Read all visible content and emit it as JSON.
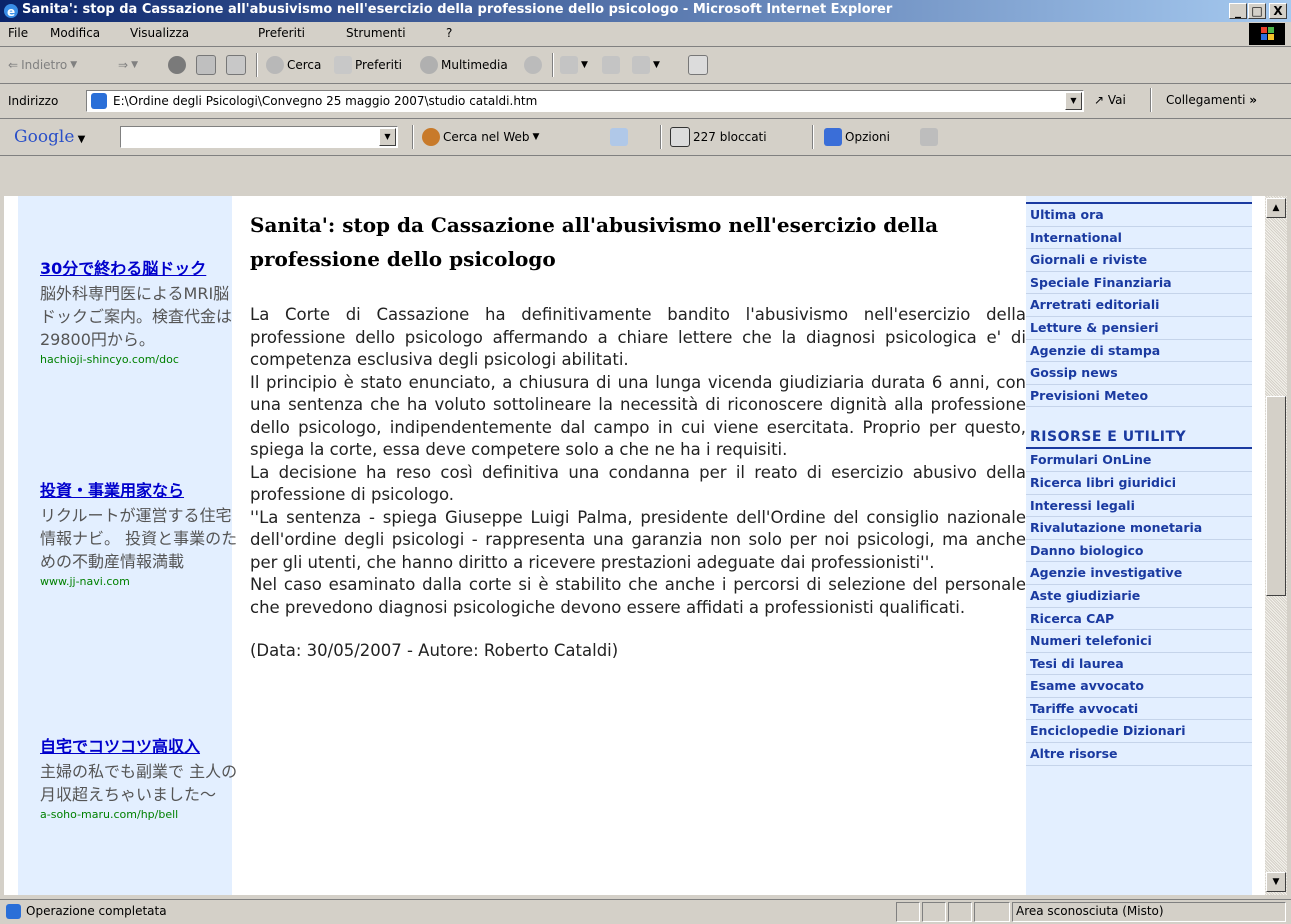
{
  "window": {
    "title": "Sanita': stop da Cassazione all'abusivismo nell'esercizio della professione dello psicologo - Microsoft Internet Explorer",
    "min_label": "_",
    "max_label": "□",
    "close_label": "X"
  },
  "menu": {
    "file": "File",
    "modifica": "Modifica",
    "visualizza": "Visualizza",
    "preferiti": "Preferiti",
    "strumenti": "Strumenti",
    "help": "?"
  },
  "toolbar": {
    "back": "Indietro",
    "search": "Cerca",
    "favorites": "Preferiti",
    "media": "Multimedia"
  },
  "address": {
    "label": "Indirizzo",
    "value": "E:\\Ordine degli Psicologi\\Convegno 25 maggio 2007\\studio cataldi.htm",
    "go": "Vai",
    "links": "Collegamenti"
  },
  "googlebar": {
    "logo": "Google",
    "search_web": "Cerca nel Web",
    "blocked": "227 bloccati",
    "options": "Opzioni",
    "search_value": ""
  },
  "ads": [
    {
      "title": "30分で終わる脳ドック",
      "body": "脳外科専門医によるMRI脳ドックご案内。検査代金は29800円から。",
      "url": "hachioji-shincyo.com/doc"
    },
    {
      "title": "投資・事業用家なら",
      "body": "リクルートが運営する住宅情報ナビ。 投資と事業のための不動産情報満載",
      "url": "www.jj-navi.com"
    },
    {
      "title": "自宅でコツコツ高収入",
      "body": "主婦の私でも副業で 主人の月収超えちゃいました～",
      "url": "a-soho-maru.com/hp/bell"
    }
  ],
  "article": {
    "title": "Sanita': stop da Cassazione all'abusivismo nell'esercizio della professione dello psicologo",
    "paragraphs": [
      "La Corte di Cassazione ha definitivamente bandito l'abusivismo nell'esercizio della professione dello psicologo affermando a chiare lettere che la diagnosi psicologica e' di competenza esclusiva degli psicologi abilitati.",
      "Il principio è stato enunciato, a chiusura di una lunga vicenda giudiziaria durata 6 anni, con una sentenza che ha voluto sottolineare la necessità di riconoscere dignità alla professione dello psicologo, indipendentemente dal campo in cui viene esercitata. Proprio per questo, spiega la corte, essa deve competere solo a che ne ha i requisiti.",
      "La decisione ha reso così definitiva una condanna per il reato di esercizio abusivo della professione di psicologo.",
      "''La sentenza - spiega Giuseppe Luigi Palma, presidente dell'Ordine del consiglio nazionale dell'ordine degli psicologi - rappresenta una garanzia non solo per noi psicologi, ma anche per gli utenti, che hanno diritto a ricevere prestazioni adeguate dai professionisti''.",
      "Nel caso esaminato dalla corte si è stabilito che anche i percorsi di selezione del personale che prevedono diagnosi psicologiche devono essere affidati a professionisti qualificati."
    ],
    "meta": "(Data: 30/05/2007 - Autore: Roberto Cataldi)"
  },
  "right_links_top": [
    "Ultima ora",
    "International",
    "Giornali e riviste",
    "Speciale Finanziaria",
    "Arretrati editoriali",
    "Letture & pensieri",
    "Agenzie di stampa",
    "Gossip news",
    "Previsioni Meteo"
  ],
  "right_section": "RISORSE E UTILITY",
  "right_links_bottom": [
    "Formulari OnLine",
    "Ricerca libri giuridici",
    "Interessi legali",
    "Rivalutazione monetaria",
    "Danno biologico",
    "Agenzie investigative",
    "Aste giudiziarie",
    "Ricerca CAP",
    "Numeri telefonici",
    "Tesi di laurea",
    "Esame avvocato",
    "Tariffe avvocati",
    "Enciclopedie Dizionari",
    "Altre risorse"
  ],
  "status": {
    "text": "Operazione completata",
    "zone": "Area sconosciuta (Misto)"
  }
}
